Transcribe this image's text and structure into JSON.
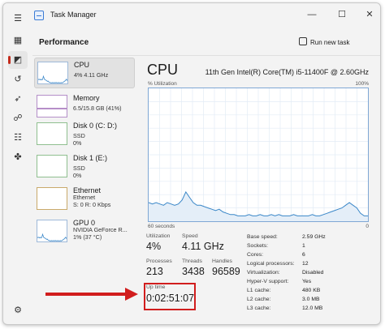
{
  "window": {
    "title": "Task Manager",
    "minimize_glyph": "—",
    "maximize_glyph": "☐",
    "close_glyph": "✕"
  },
  "rail": {
    "items": [
      {
        "icon": "hamburger-menu-icon",
        "glyph": "☰"
      },
      {
        "icon": "processes-icon",
        "glyph": "▦"
      },
      {
        "icon": "performance-icon",
        "glyph": "◩",
        "active": true
      },
      {
        "icon": "app-history-icon",
        "glyph": "↺"
      },
      {
        "icon": "startup-apps-icon",
        "glyph": "➶"
      },
      {
        "icon": "users-icon",
        "glyph": "☍"
      },
      {
        "icon": "details-icon",
        "glyph": "☷"
      },
      {
        "icon": "services-icon",
        "glyph": "✤"
      },
      {
        "icon": "settings-icon",
        "glyph": "⚙"
      }
    ]
  },
  "header": {
    "page_title": "Performance",
    "run_new_task": "Run new task"
  },
  "resources": [
    {
      "name": "CPU",
      "sub1": "4% 4.11 GHz",
      "sub2": "",
      "kind": "cpu",
      "selected": true
    },
    {
      "name": "Memory",
      "sub1": "6.5/15.8 GB (41%)",
      "sub2": "",
      "kind": "mem"
    },
    {
      "name": "Disk 0 (C: D:)",
      "sub1": "SSD",
      "sub2": "0%",
      "kind": "disk"
    },
    {
      "name": "Disk 1 (E:)",
      "sub1": "SSD",
      "sub2": "0%",
      "kind": "disk"
    },
    {
      "name": "Ethernet",
      "sub1": "Ethernet",
      "sub2": "S: 0 R: 0 Kbps",
      "kind": "eth"
    },
    {
      "name": "GPU 0",
      "sub1": "NVIDIA GeForce R...",
      "sub2": "1% (37 °C)",
      "kind": "cpu"
    }
  ],
  "main": {
    "title": "CPU",
    "model": "11th Gen Intel(R) Core(TM) i5-11400F @ 2.60GHz",
    "util_label": "% Utilization",
    "util_max": "100%",
    "x_left": "60 seconds",
    "x_right": "0",
    "stats": {
      "utilization_label": "Utilization",
      "utilization_value": "4%",
      "speed_label": "Speed",
      "speed_value": "4.11 GHz",
      "processes_label": "Processes",
      "processes_value": "213",
      "threads_label": "Threads",
      "threads_value": "3438",
      "handles_label": "Handles",
      "handles_value": "96589",
      "uptime_label": "Up time",
      "uptime_value": "0:02:51:07"
    },
    "specs": [
      {
        "label": "Base speed:",
        "value": "2.59 GHz"
      },
      {
        "label": "Sockets:",
        "value": "1"
      },
      {
        "label": "Cores:",
        "value": "6"
      },
      {
        "label": "Logical processors:",
        "value": "12"
      },
      {
        "label": "Virtualization:",
        "value": "Disabled"
      },
      {
        "label": "Hyper-V support:",
        "value": "Yes"
      },
      {
        "label": "L1 cache:",
        "value": "480 KB"
      },
      {
        "label": "L2 cache:",
        "value": "3.0 MB"
      },
      {
        "label": "L3 cache:",
        "value": "12.0 MB"
      }
    ]
  },
  "cpu_graph": {
    "series": [
      14,
      13,
      14,
      13,
      12,
      14,
      13,
      12,
      13,
      16,
      22,
      18,
      14,
      12,
      12,
      11,
      10,
      9,
      8,
      9,
      7,
      6,
      5,
      5,
      4,
      4,
      4,
      5,
      4,
      4,
      5,
      4,
      4,
      5,
      4,
      5,
      4,
      4,
      4,
      5,
      4,
      4,
      4,
      4,
      5,
      4,
      4,
      5,
      6,
      7,
      8,
      9,
      10,
      12,
      14,
      12,
      10,
      6,
      4,
      4
    ]
  },
  "colors": {
    "cpu_line": "#3a87c8",
    "cpu_fill": "#e4eef8",
    "mem_line": "#8b4aa8",
    "disk_line": "#4a9a4a",
    "eth_line": "#b8893a",
    "annotation": "#d11d1d"
  }
}
